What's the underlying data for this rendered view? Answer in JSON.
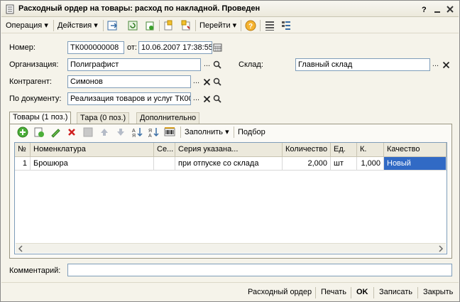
{
  "window": {
    "title": "Расходный ордер на товары: расход по накладной. Проведен"
  },
  "toolbar": {
    "operation": "Операция",
    "actions": "Действия",
    "goto": "Перейти"
  },
  "form": {
    "number_label": "Номер:",
    "number_value": "ТК000000008",
    "date_label": "от:",
    "date_value": "10.06.2007 17:38:55",
    "org_label": "Организация:",
    "org_value": "Полиграфист",
    "warehouse_label": "Склад:",
    "warehouse_value": "Главный склад",
    "counterparty_label": "Контрагент:",
    "counterparty_value": "Симонов",
    "document_label": "По документу:",
    "document_value": "Реализация товаров и услуг ТК00"
  },
  "tabs": [
    {
      "label": "Товары (1 поз.)"
    },
    {
      "label": "Тара (0 поз.)"
    },
    {
      "label": "Дополнительно"
    }
  ],
  "grid_toolbar": {
    "fill": "Заполнить",
    "pick": "Подбор"
  },
  "table": {
    "columns": [
      "№",
      "Номенклатура",
      "Се...",
      "Серия указана...",
      "Количество",
      "Ед.",
      "К.",
      "Качество"
    ],
    "rows": [
      [
        "1",
        "Брошюра",
        "",
        "при отпуске со склада",
        "2,000",
        "шт",
        "1,000",
        "Новый"
      ]
    ]
  },
  "comment": {
    "label": "Комментарий:",
    "value": ""
  },
  "footer": {
    "expense_order": "Расходный ордер",
    "print": "Печать",
    "ok": "OK",
    "save": "Записать",
    "close": "Закрыть"
  },
  "colors": {
    "selection": "#316ac5",
    "window_bg": "#f5f3ea"
  }
}
